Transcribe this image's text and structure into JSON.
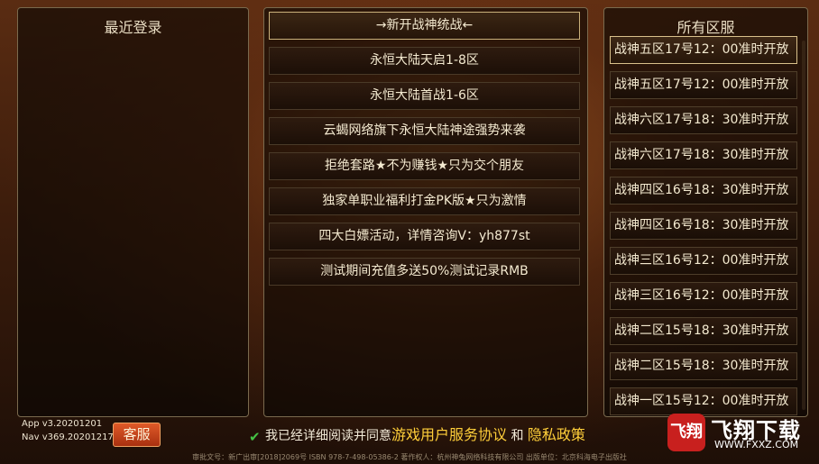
{
  "left_panel": {
    "title": "最近登录"
  },
  "notices": {
    "items": [
      "→新开战神统战←",
      "永恒大陆天启1-8区",
      "永恒大陆首战1-6区",
      "云蝎网络旗下永恒大陆神途强势来袭",
      "拒绝套路★不为赚钱★只为交个朋友",
      "独家单职业福利打金PK版★只为激情",
      "四大白嫖活动，详情咨询V：yh877st",
      "测试期间充值多送50%测试记录RMB"
    ]
  },
  "servers": {
    "title": "所有区服",
    "items": [
      "战神五区17号12：00准时开放",
      "战神五区17号12：00准时开放",
      "战神六区17号18：30准时开放",
      "战神六区17号18：30准时开放",
      "战神四区16号18：30准时开放",
      "战神四区16号18：30准时开放",
      "战神三区16号12：00准时开放",
      "战神三区16号12：00准时开放",
      "战神二区15号18：30准时开放",
      "战神二区15号18：30准时开放",
      "战神一区15号12：00准时开放"
    ]
  },
  "version": {
    "app": "App v3.20201201",
    "nav": "Nav v369.20201217"
  },
  "service_button": "客服",
  "agreement": {
    "checked": true,
    "prefix": "我已经详细阅读并同意",
    "terms_link": "游戏用户服务协议",
    "conjunction": "和",
    "privacy_link": "隐私政策"
  },
  "footer": "审批文号：新广出审[2018]2069号 ISBN 978-7-498-05386-2 著作权人：杭州神兔网络科技有限公司 出版单位：北京科海电子出版社",
  "watermark": {
    "logo": "飞翔",
    "name": "飞翔下载",
    "url": "WWW.FXXZ.COM"
  },
  "colors": {
    "link": "#ffcf3a",
    "button": "#c8401a",
    "check": "#44c244"
  }
}
